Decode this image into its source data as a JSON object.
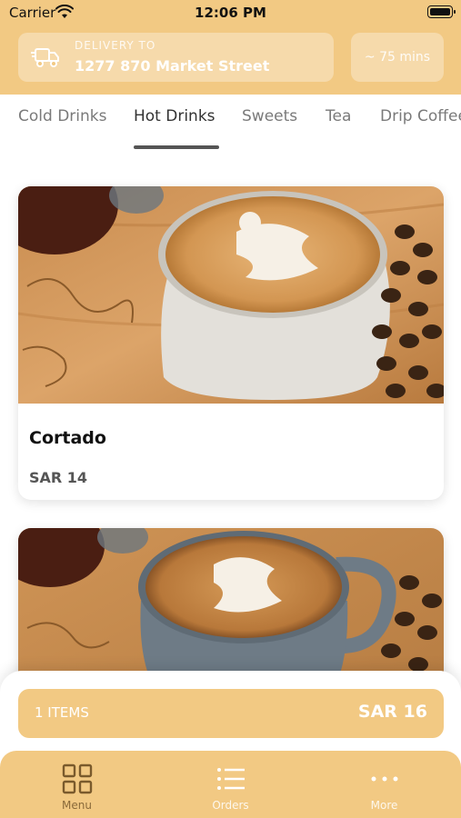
{
  "status_bar": {
    "carrier": "Carrier",
    "time": "12:06 PM"
  },
  "delivery": {
    "label": "DELIVERY TO",
    "address": "1277 870 Market Street",
    "eta": "~ 75 mins"
  },
  "tabs": [
    {
      "label": "Cold Drinks",
      "active": false
    },
    {
      "label": "Hot Drinks",
      "active": true
    },
    {
      "label": "Sweets",
      "active": false
    },
    {
      "label": "Tea",
      "active": false
    },
    {
      "label": "Drip Coffee",
      "active": false
    }
  ],
  "products": [
    {
      "name": "Cortado",
      "price": "SAR 14"
    },
    {
      "name": "",
      "price": ""
    }
  ],
  "cart": {
    "items": "1 ITEMS",
    "total": "SAR 16"
  },
  "nav": [
    {
      "label": "Menu",
      "icon": "grid-icon",
      "active": true
    },
    {
      "label": "Orders",
      "icon": "list-icon",
      "active": false
    },
    {
      "label": "More",
      "icon": "more-dots-icon",
      "active": false
    }
  ],
  "colors": {
    "accent": "#f2c983",
    "text_dark": "#111111",
    "tab_inactive": "#7a7a7a"
  }
}
